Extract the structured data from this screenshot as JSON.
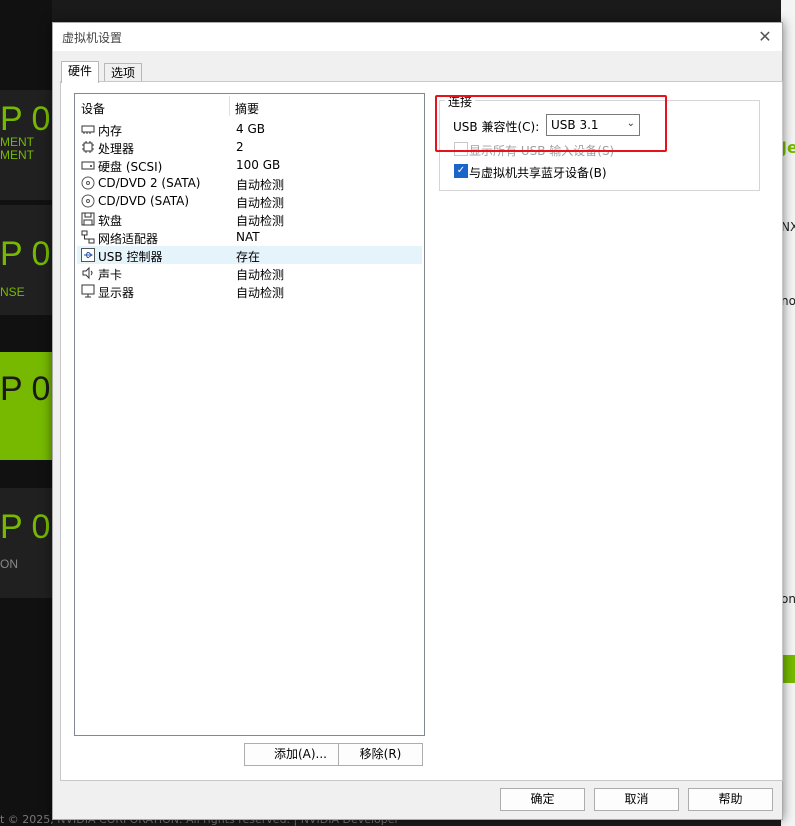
{
  "dialog": {
    "title": "虚拟机设置",
    "close_glyph": "✕",
    "tabs": [
      {
        "label": "硬件",
        "active": true
      },
      {
        "label": "选项",
        "active": false
      }
    ]
  },
  "hardware": {
    "columns": {
      "device": "设备",
      "summary": "摘要"
    },
    "devices": [
      {
        "name": "内存",
        "summary": "4 GB",
        "icon": "memory-icon"
      },
      {
        "name": "处理器",
        "summary": "2",
        "icon": "processor-icon"
      },
      {
        "name": "硬盘 (SCSI)",
        "summary": "100 GB",
        "icon": "hard-disk-icon"
      },
      {
        "name": "CD/DVD 2 (SATA)",
        "summary": "自动检测",
        "icon": "cd-dvd-icon"
      },
      {
        "name": "CD/DVD (SATA)",
        "summary": "自动检测",
        "icon": "cd-dvd-icon"
      },
      {
        "name": "软盘",
        "summary": "自动检测",
        "icon": "floppy-icon"
      },
      {
        "name": "网络适配器",
        "summary": "NAT",
        "icon": "network-adapter-icon"
      },
      {
        "name": "USB 控制器",
        "summary": "存在",
        "icon": "usb-icon",
        "selected": true
      },
      {
        "name": "声卡",
        "summary": "自动检测",
        "icon": "speaker-icon"
      },
      {
        "name": "显示器",
        "summary": "自动检测",
        "icon": "monitor-icon"
      }
    ],
    "add_button": "添加(A)...",
    "remove_button": "移除(R)"
  },
  "connection": {
    "group_label": "连接",
    "usb_compat_label": "USB 兼容性(C):",
    "usb_compat_value": "USB 3.1",
    "show_all_usb_input": {
      "label": "显示所有 USB 输入设备(S)",
      "checked": false,
      "disabled": true
    },
    "share_bluetooth": {
      "label": "与虚拟机共享蓝牙设备(B)",
      "checked": true
    }
  },
  "footer_buttons": {
    "ok": "确定",
    "cancel": "取消",
    "help": "帮助"
  },
  "background": {
    "left_texts": [
      "P 0",
      "MENT",
      "MENT",
      "P 0",
      "NSE",
      "P 0",
      "P 0",
      "ON"
    ],
    "right_texts": [
      "Je",
      "NX",
      "no",
      "on"
    ],
    "footer": "t © 2025, NVIDIA CORPORATION. All rights reserved. | NVIDIA Developer"
  },
  "colors": {
    "accent": "#76b900",
    "highlight": "#e8131a",
    "selection": "#e5f3fb"
  }
}
